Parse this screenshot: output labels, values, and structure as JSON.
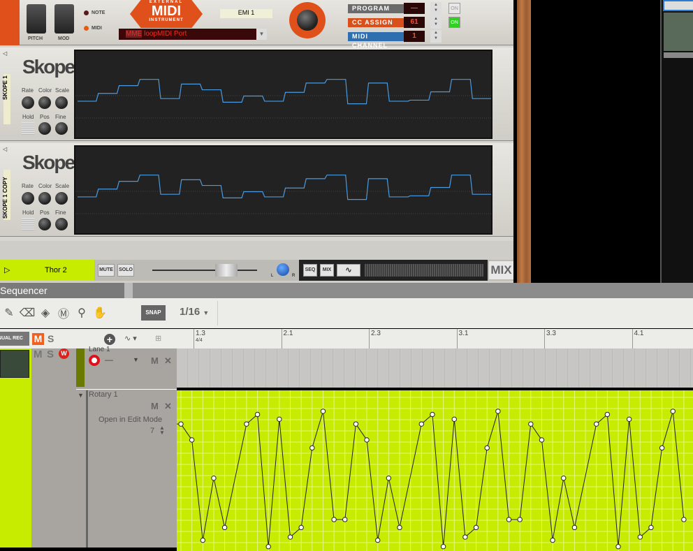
{
  "midi_device": {
    "brand_top": "EXTERNAL",
    "brand_main": "MIDI",
    "brand_bottom": "INSTRUMENT",
    "pitch_label": "PITCH",
    "mod_label": "MOD",
    "note_label": "NOTE",
    "midi_label": "MIDI",
    "name_display": "EMI 1",
    "port": "loopMIDI Port",
    "port_prefix": "MME",
    "rows": [
      {
        "label": "PROGRAM",
        "value": "—",
        "on": "ON",
        "on_active": false,
        "color": "#6b6b6b"
      },
      {
        "label": "CC ASSIGN",
        "value": "61",
        "on": "ON",
        "on_active": true,
        "color": "#d8501c"
      },
      {
        "label": "MIDI CHANNEL",
        "value": "1",
        "color": "#2f6fb0"
      }
    ]
  },
  "skopes": [
    {
      "tab": "SKOPE 1",
      "logo": "Skope",
      "knobs": [
        "Rate",
        "Color",
        "Scale"
      ],
      "hold": "Hold",
      "pos": "Pos",
      "fine": "Fine",
      "trace": [
        0.45,
        0.6,
        0.75,
        0.87,
        0.5,
        0.78,
        0.67,
        0.43,
        0.55,
        0.45,
        0.62,
        0.8,
        0.87,
        0.4,
        0.8,
        0.45,
        0.47,
        0.63,
        0.87,
        0.5
      ]
    },
    {
      "tab": "SKOPE 1 COPY",
      "logo": "Skope",
      "knobs": [
        "Rate",
        "Color",
        "Scale"
      ],
      "hold": "Hold",
      "pos": "Pos",
      "fine": "Fine",
      "trace": [
        0.45,
        0.6,
        0.75,
        0.87,
        0.5,
        0.78,
        0.67,
        0.43,
        0.55,
        0.45,
        0.62,
        0.8,
        0.87,
        0.4,
        0.8,
        0.45,
        0.47,
        0.63,
        0.87,
        0.5
      ]
    }
  ],
  "mixer_strip": {
    "track": "Thor 2",
    "mute": "MUTE",
    "solo": "SOLO",
    "seq": "SEQ",
    "mix": "MIX",
    "mix_big": "MIX",
    "pan_l": "L",
    "pan_r": "R"
  },
  "sequencer": {
    "title": "Sequencer",
    "snap": "SNAP",
    "grid": "1/16",
    "ruler": [
      {
        "label": "1.3",
        "sub": "4/4"
      },
      {
        "label": "2.1"
      },
      {
        "label": "2.3"
      },
      {
        "label": "3.1"
      },
      {
        "label": "3.3"
      },
      {
        "label": "4.1"
      }
    ],
    "track_header": {
      "rec": "MANUAL REC",
      "m": "M",
      "s": "S"
    },
    "track": {
      "m": "M",
      "s": "S",
      "lane": "Lane 1",
      "lane_m": "M",
      "lane_x": "✕",
      "lane_dash": "—"
    },
    "automation": {
      "name": "Rotary 1",
      "m": "M",
      "x": "✕",
      "edit": "Open in Edit Mode",
      "value": "7",
      "lane_color": "#c8ec00",
      "points": [
        [
          0,
          0.78
        ],
        [
          1,
          0.68
        ],
        [
          2,
          0.05
        ],
        [
          3,
          0.44
        ],
        [
          4,
          0.13
        ],
        [
          6,
          0.78
        ],
        [
          7,
          0.84
        ],
        [
          8,
          0.01
        ],
        [
          9,
          0.81
        ],
        [
          10,
          0.07
        ],
        [
          11,
          0.13
        ],
        [
          12,
          0.63
        ],
        [
          13,
          0.86
        ],
        [
          14,
          0.18
        ],
        [
          15,
          0.18
        ],
        [
          16,
          0.78
        ],
        [
          17,
          0.68
        ],
        [
          18,
          0.05
        ],
        [
          19,
          0.44
        ],
        [
          20,
          0.13
        ],
        [
          22,
          0.78
        ],
        [
          23,
          0.84
        ],
        [
          24,
          0.01
        ],
        [
          25,
          0.81
        ],
        [
          26,
          0.07
        ],
        [
          27,
          0.13
        ],
        [
          28,
          0.63
        ],
        [
          29,
          0.86
        ],
        [
          30,
          0.18
        ],
        [
          31,
          0.18
        ],
        [
          32,
          0.78
        ],
        [
          33,
          0.68
        ],
        [
          34,
          0.05
        ],
        [
          35,
          0.44
        ],
        [
          36,
          0.13
        ],
        [
          38,
          0.78
        ],
        [
          39,
          0.84
        ],
        [
          40,
          0.01
        ],
        [
          41,
          0.81
        ],
        [
          42,
          0.07
        ],
        [
          43,
          0.13
        ],
        [
          44,
          0.63
        ],
        [
          45,
          0.86
        ],
        [
          46,
          0.18
        ]
      ]
    }
  }
}
